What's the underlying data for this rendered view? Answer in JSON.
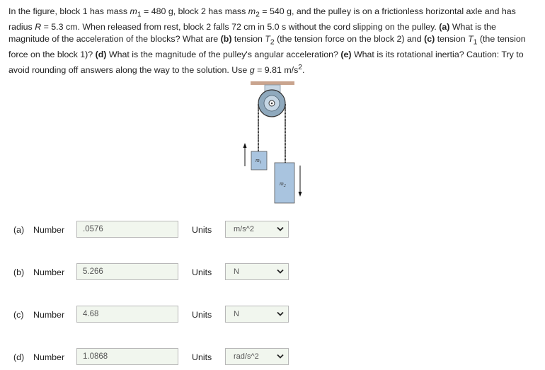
{
  "problem": {
    "s1": "In the figure, block 1 has mass ",
    "m1_sym": "m",
    "m1_sub": "1",
    "s2": " = 480 g, block 2 has mass ",
    "m2_sym": "m",
    "m2_sub": "2",
    "s3": " = 540 g, and the pulley is on a frictionless horizontal axle and has radius ",
    "r_sym": "R",
    "s4": " = 5.3 cm. When released from rest, block 2 falls 72 cm in 5.0 s without the cord slipping on the pulley. ",
    "qa_label": "(a)",
    "qa_text": " What is the magnitude of the acceleration of the blocks? What are ",
    "qb_label": "(b)",
    "qb_text": " tension ",
    "t2_sym": "T",
    "t2_sub": "2",
    "qb_text2": " (the tension force on the block 2) and ",
    "qc_label": "(c)",
    "qc_text": " tension ",
    "t1_sym": "T",
    "t1_sub": "1",
    "qc_text2": " (the tension force on the block 1)? ",
    "qd_label": "(d)",
    "qd_text": " What is the magnitude of the pulley's angular acceleration? ",
    "qe_label": "(e)",
    "qe_text": " What is its rotational inertia? Caution: Try to avoid rounding off answers along the way to the solution. Use ",
    "g_sym": "g",
    "g_text": " = 9.81 m/s",
    "g_sup": "2",
    "end": "."
  },
  "figure": {
    "block1_label": "m",
    "block1_sub": "1",
    "block2_label": "m",
    "block2_sub": "2",
    "colors": {
      "block": "#a9c4df",
      "ceiling": "#c9a48e",
      "pulley": "#8fa9bd",
      "cord": "#333333"
    }
  },
  "rows": [
    {
      "part": "(a)",
      "number_label": "Number",
      "value": ".0576",
      "units_label": "Units",
      "unit": "m/s^2"
    },
    {
      "part": "(b)",
      "number_label": "Number",
      "value": "5.266",
      "units_label": "Units",
      "unit": "N"
    },
    {
      "part": "(c)",
      "number_label": "Number",
      "value": "4.68",
      "units_label": "Units",
      "unit": "N"
    },
    {
      "part": "(d)",
      "number_label": "Number",
      "value": "1.0868",
      "units_label": "Units",
      "unit": "rad/s^2"
    }
  ]
}
